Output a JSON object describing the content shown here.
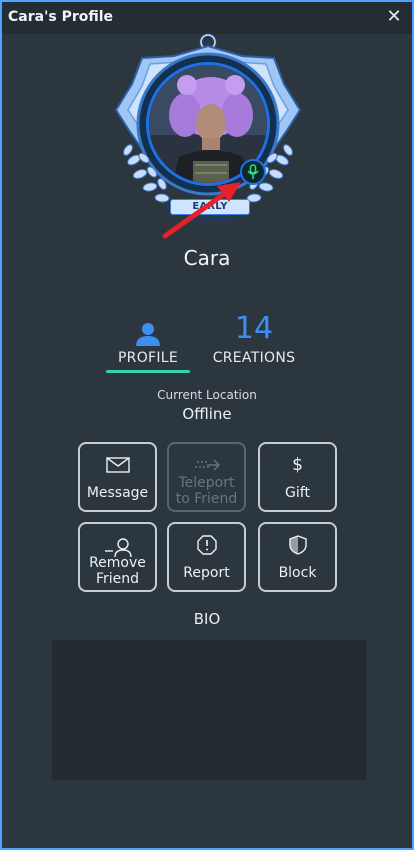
{
  "window": {
    "title": "Cara's Profile",
    "close_glyph": "✕"
  },
  "profile": {
    "badge_text": "EARLY ACCESS",
    "username": "Cara"
  },
  "tabs": [
    {
      "label": "PROFILE",
      "icon": "person-icon",
      "active": true
    },
    {
      "label": "CREATIONS",
      "count": "14",
      "active": false
    }
  ],
  "location": {
    "label": "Current Location",
    "value": "Offline"
  },
  "actions": [
    {
      "label": "Message",
      "icon": "envelope-icon",
      "enabled": true
    },
    {
      "label_line1": "Teleport",
      "label_line2": "to Friend",
      "icon": "teleport-arrow-icon",
      "enabled": false
    },
    {
      "label": "Gift",
      "icon": "dollar-icon",
      "enabled": true
    },
    {
      "label_line1": "Remove",
      "label_line2": "Friend",
      "icon": "remove-friend-icon",
      "enabled": true
    },
    {
      "label": "Report",
      "icon": "report-octagon-icon",
      "enabled": true
    },
    {
      "label": "Block",
      "icon": "shield-icon",
      "enabled": true
    }
  ],
  "bio": {
    "label": "BIO",
    "text": ""
  },
  "colors": {
    "accent_blue": "#3c8ff0",
    "tab_underline": "#33d6a8",
    "annotation_arrow": "#e8202a",
    "mic_green": "#2fe08a"
  }
}
